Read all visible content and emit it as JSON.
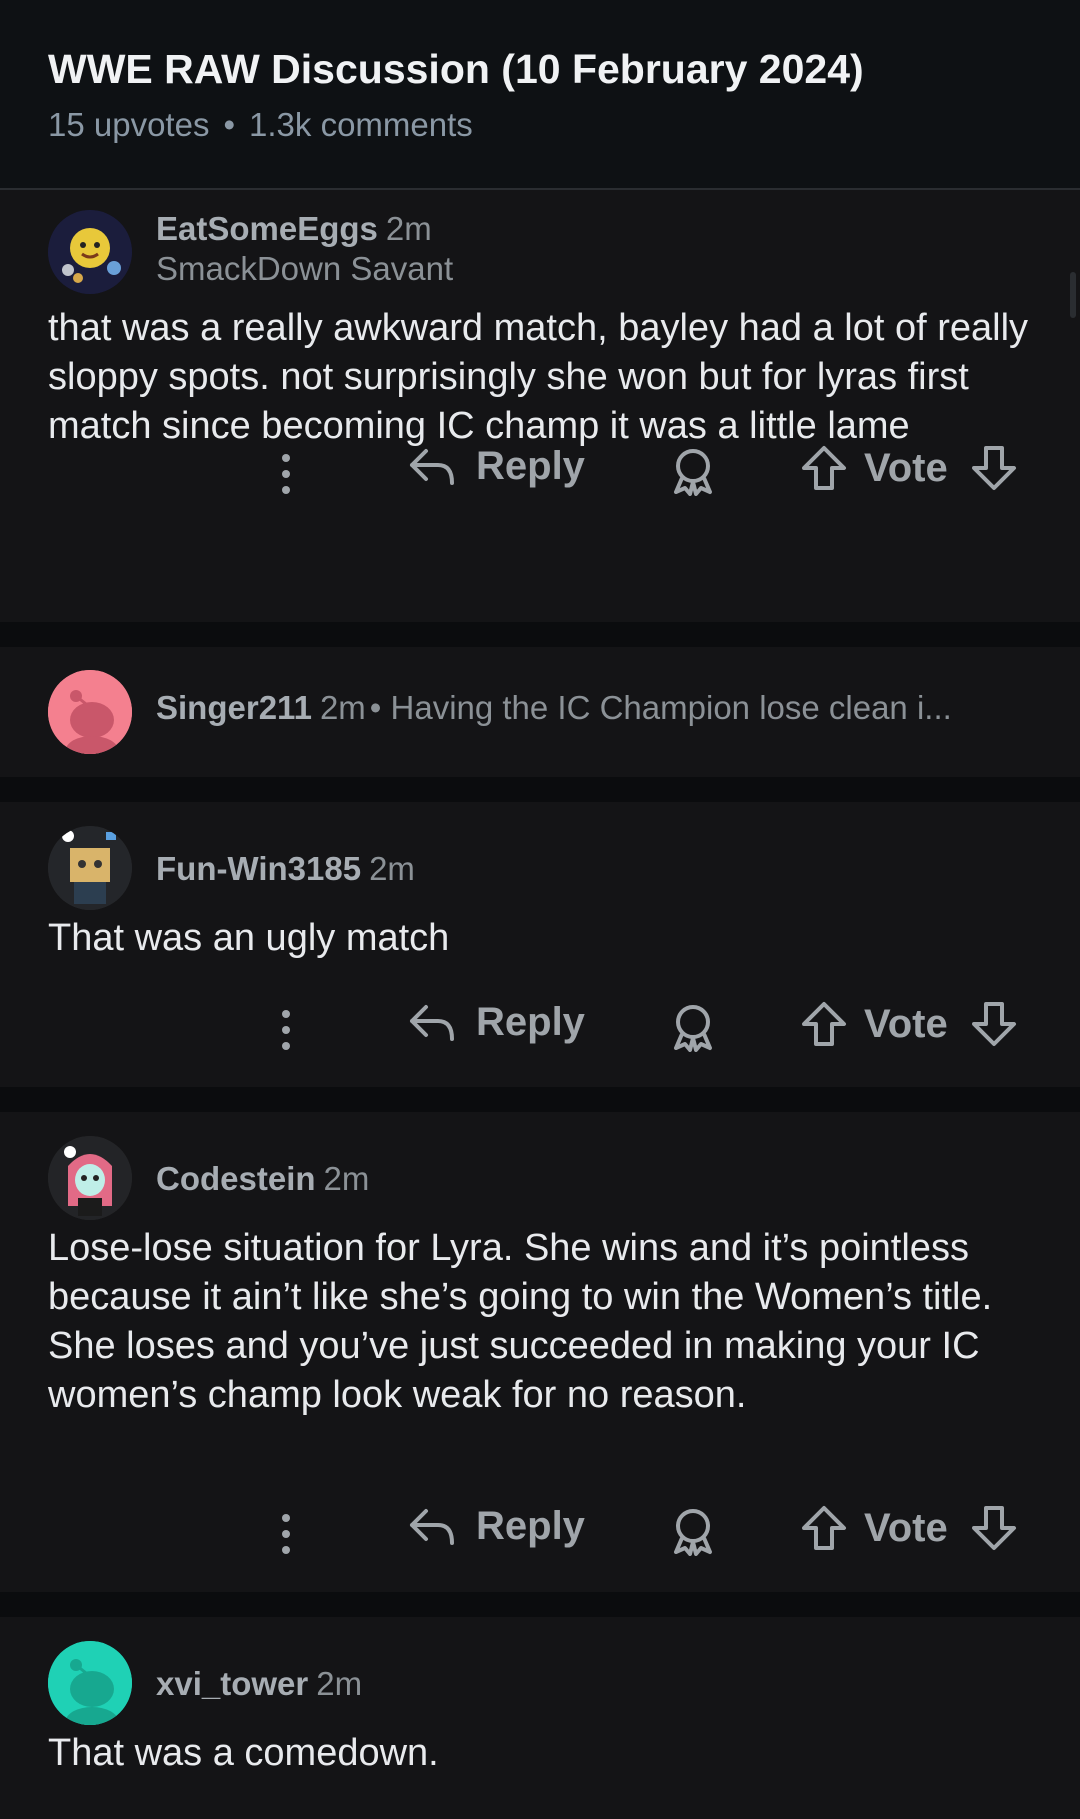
{
  "post": {
    "title": "WWE RAW Discussion (10 February 2024)",
    "upvotes": "15 upvotes",
    "separator": "•",
    "comments": "1.3k comments"
  },
  "actions": {
    "reply": "Reply",
    "vote": "Vote"
  },
  "comments": [
    {
      "username": "EatSomeEggs",
      "time": "2m",
      "flair": "SmackDown Savant",
      "body": "that was a really awkward match, bayley had a lot of really sloppy spots. not surprisingly she won but for lyras first match since becoming IC champ it was a little lame"
    },
    {
      "username": "Singer211",
      "time": "2m",
      "collapsed_preview": "• Having the IC Champion lose clean i..."
    },
    {
      "username": "Fun-Win3185",
      "time": "2m",
      "body": "That was an ugly match"
    },
    {
      "username": "Codestein",
      "time": "2m",
      "body": "Lose-lose situation for Lyra. She wins and it’s pointless because it ain’t like she’s going to win the Women’s title. She loses and you’ve just succeeded in making your IC women’s champ look weak for no reason."
    },
    {
      "username": "xvi_tower",
      "time": "2m",
      "body": "That was a comedown."
    }
  ],
  "colors": {
    "background": "#0b0c0e",
    "card": "#141416",
    "text": "#e8eaed",
    "muted": "#8b9196",
    "avatar_pink": "#f4808f",
    "avatar_teal": "#1fd1b5"
  }
}
